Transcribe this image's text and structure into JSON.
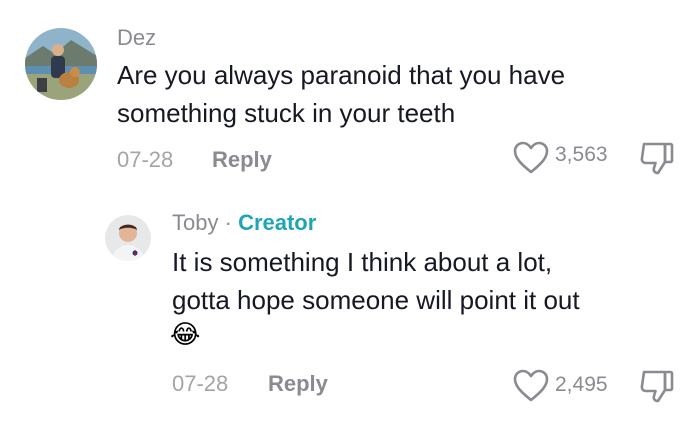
{
  "comment": {
    "username": "Dez",
    "avatar_icon": "avatar-photo-dez",
    "text_lines": [
      "Are you always paranoid that you have",
      "something stuck in your teeth"
    ],
    "date": "07-28",
    "reply_label": "Reply",
    "like_count": "3,563",
    "like_icon": "heart-outline-icon",
    "dislike_icon": "thumbs-down-icon"
  },
  "reply": {
    "username": "Toby",
    "separator": "·",
    "badge": "Creator",
    "avatar_icon": "avatar-photo-toby",
    "text_lines": [
      "It is something I think about a lot,",
      "gotta hope someone will point it out"
    ],
    "emoji": "😂",
    "date": "07-28",
    "reply_label": "Reply",
    "like_count": "2,495",
    "like_icon": "heart-outline-icon",
    "dislike_icon": "thumbs-down-icon"
  },
  "colors": {
    "creator_badge": "#20a4b8",
    "meta_text": "#8a8b91",
    "body_text": "#161823"
  }
}
